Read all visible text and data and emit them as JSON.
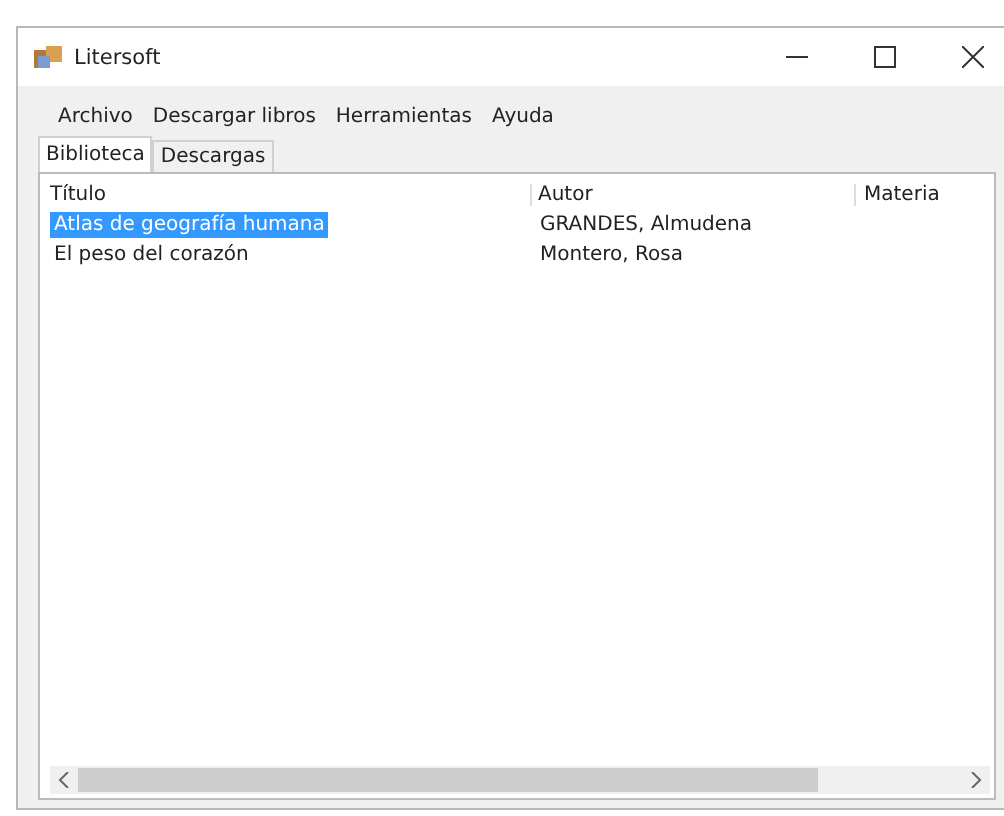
{
  "window": {
    "title": "Litersoft"
  },
  "menu": [
    "Archivo",
    "Descargar libros",
    "Herramientas",
    "Ayuda"
  ],
  "tabs": [
    {
      "label": "Biblioteca",
      "selected": true
    },
    {
      "label": "Descargas",
      "selected": false
    }
  ],
  "table": {
    "columns": [
      "Título",
      "Autor",
      "Materia"
    ],
    "rows": [
      {
        "cells": [
          "Atlas de geografía humana",
          "GRANDES, Almudena"
        ],
        "selected": true
      },
      {
        "cells": [
          "El peso del corazón",
          "Montero, Rosa"
        ],
        "selected": false
      }
    ]
  }
}
